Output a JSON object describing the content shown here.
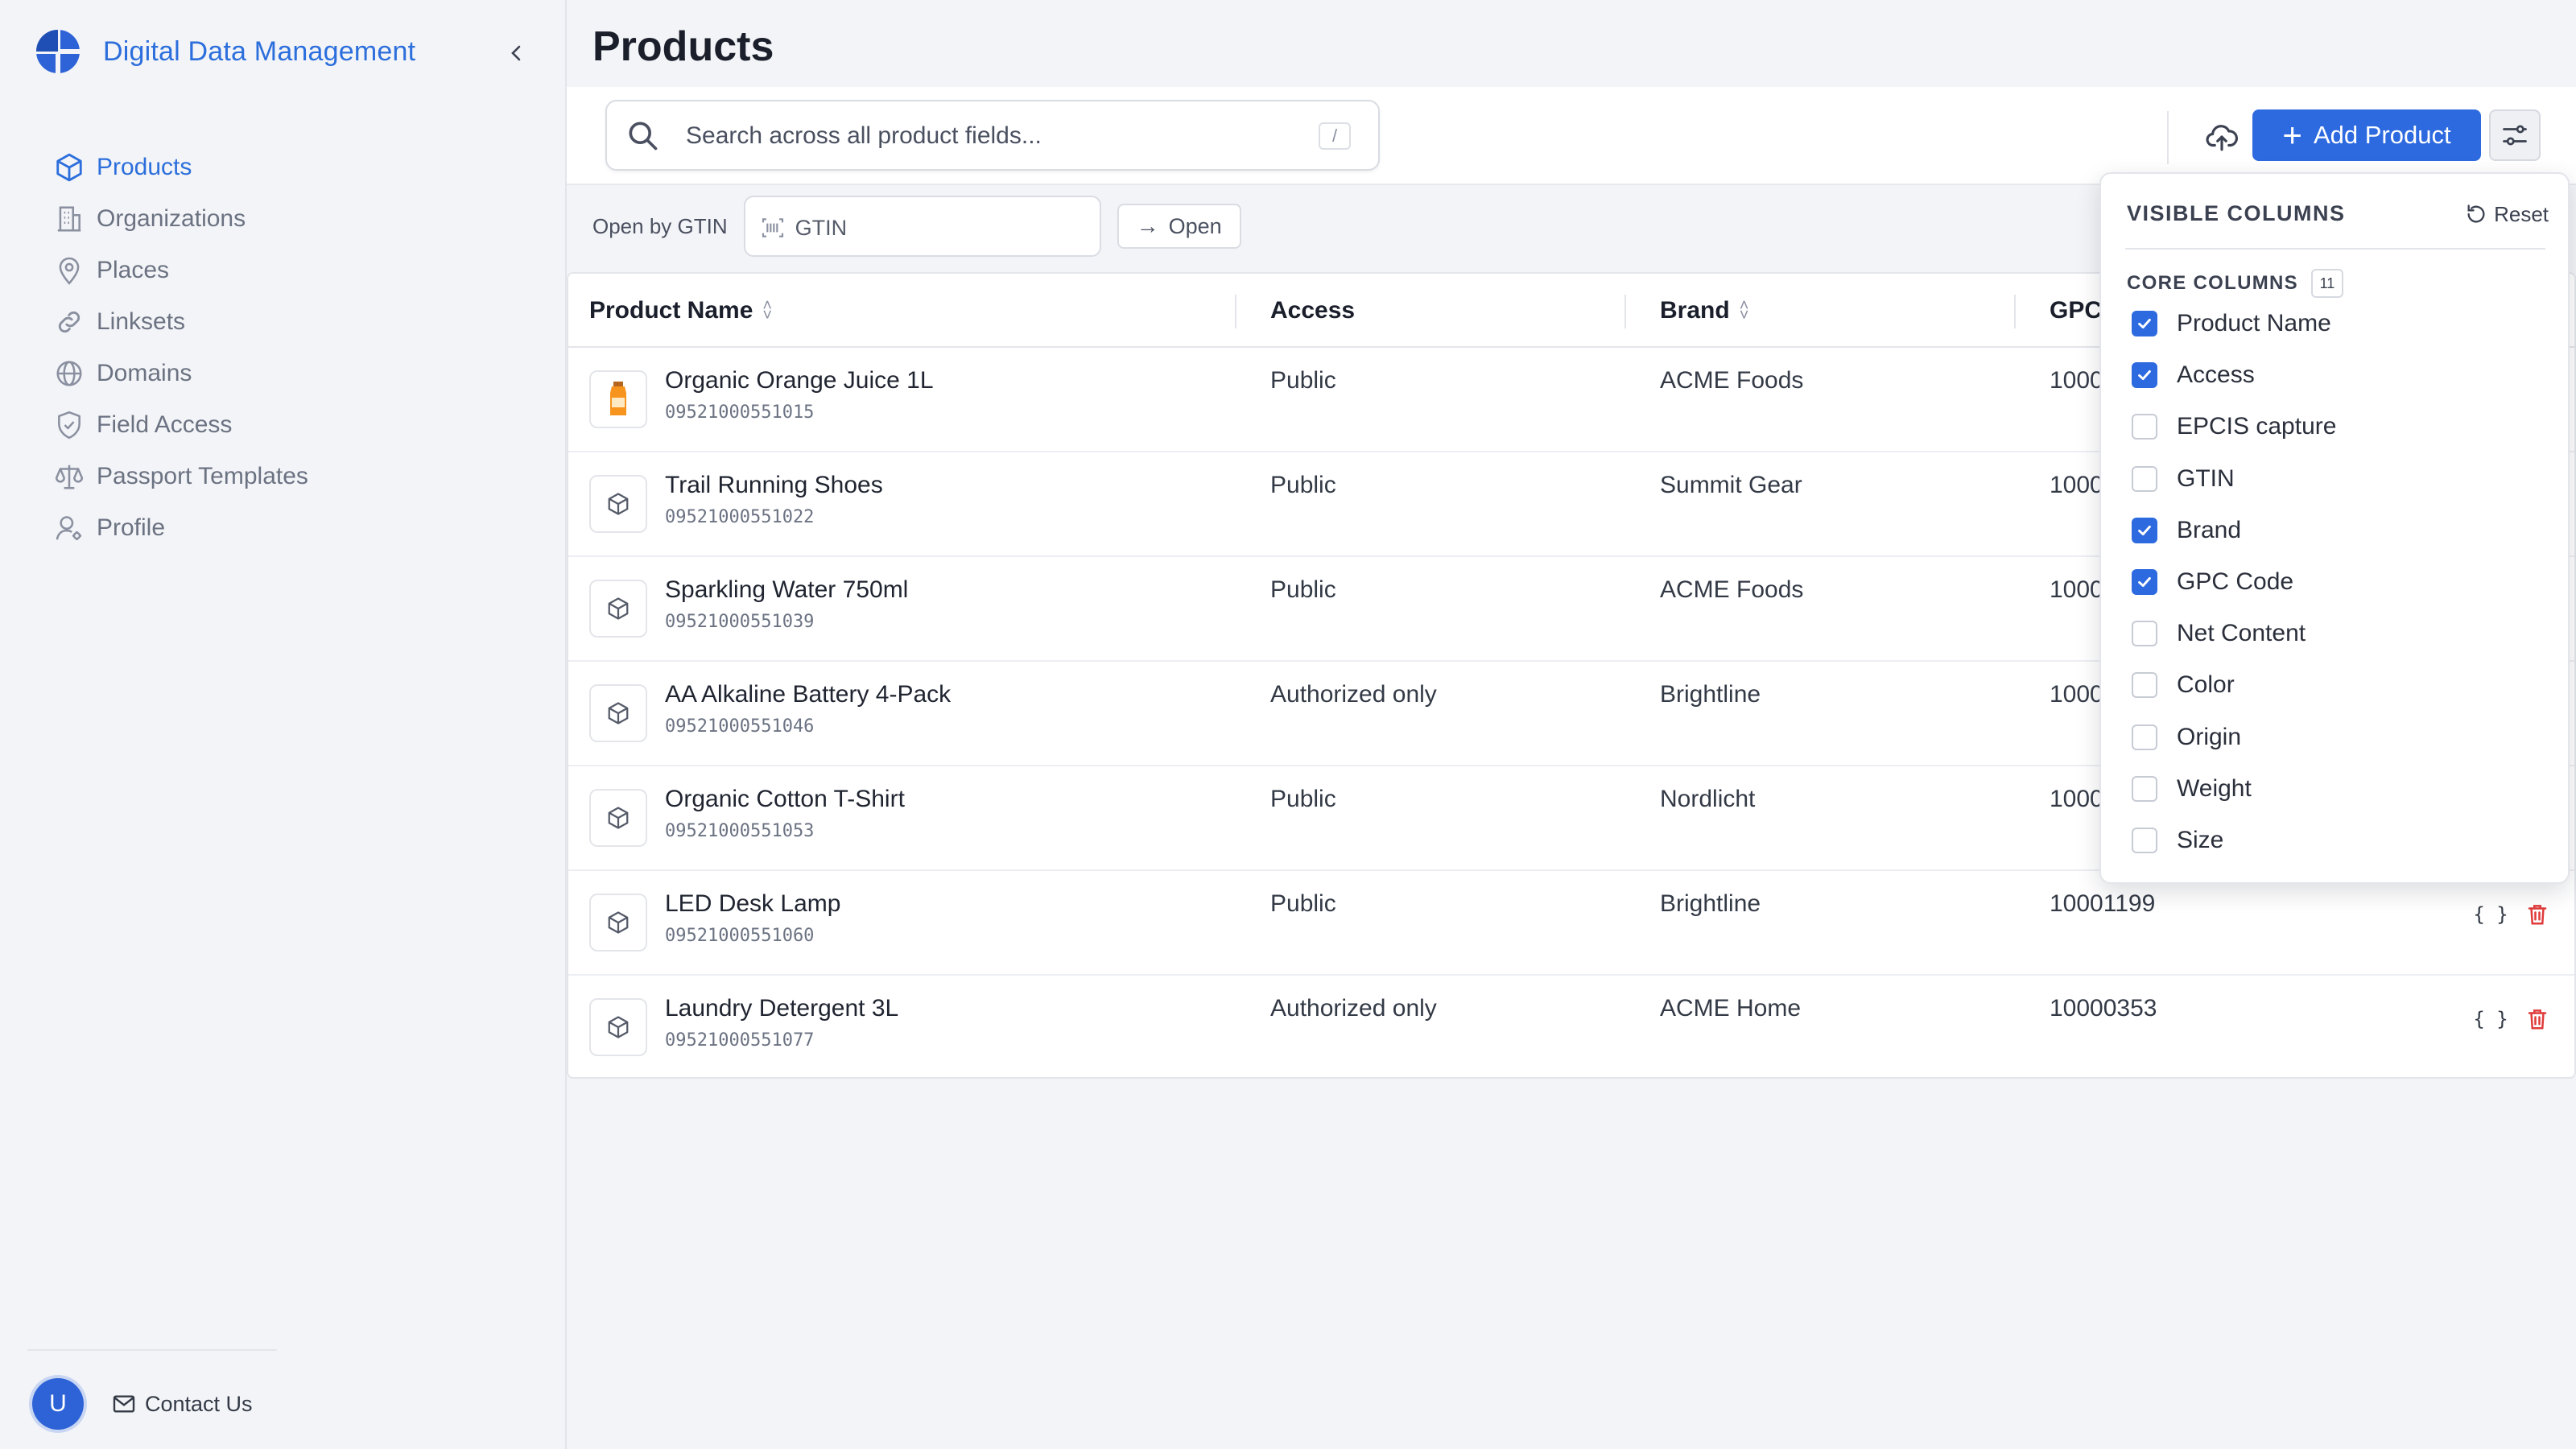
{
  "app": {
    "title": "Digital Data Management",
    "accent_color": "#2d6ae0"
  },
  "sidebar": {
    "items": [
      {
        "label": "Products",
        "icon": "cube-icon",
        "active": true
      },
      {
        "label": "Organizations",
        "icon": "building-icon",
        "active": false
      },
      {
        "label": "Places",
        "icon": "map-pin-icon",
        "active": false
      },
      {
        "label": "Linksets",
        "icon": "link-icon",
        "active": false
      },
      {
        "label": "Domains",
        "icon": "globe-icon",
        "active": false
      },
      {
        "label": "Field Access",
        "icon": "shield-check-icon",
        "active": false
      },
      {
        "label": "Passport Templates",
        "icon": "scale-icon",
        "active": false
      },
      {
        "label": "Profile",
        "icon": "user-cog-icon",
        "active": false
      }
    ],
    "avatar_initial": "U",
    "contact_label": "Contact Us"
  },
  "page": {
    "title": "Products"
  },
  "toolbar": {
    "search_placeholder": "Search across all product fields...",
    "search_shortcut": "/",
    "add_label": "Add Product"
  },
  "gtin_bar": {
    "label": "Open by GTIN",
    "placeholder": "GTIN",
    "open_label": "Open"
  },
  "table": {
    "headers": {
      "name": "Product Name",
      "access": "Access",
      "brand": "Brand",
      "gpc": "GPC Code"
    },
    "rows": [
      {
        "name": "Organic Orange Juice 1L",
        "gtin": "09521000551015",
        "access": "Public",
        "brand": "ACME Foods",
        "gpc": "1000"
      },
      {
        "name": "Trail Running Shoes",
        "gtin": "09521000551022",
        "access": "Public",
        "brand": "Summit Gear",
        "gpc": "1000"
      },
      {
        "name": "Sparkling Water 750ml",
        "gtin": "09521000551039",
        "access": "Public",
        "brand": "ACME Foods",
        "gpc": "1000"
      },
      {
        "name": "AA Alkaline Battery 4-Pack",
        "gtin": "09521000551046",
        "access": "Authorized only",
        "brand": "Brightline",
        "gpc": "1000"
      },
      {
        "name": "Organic Cotton T-Shirt",
        "gtin": "09521000551053",
        "access": "Public",
        "brand": "Nordlicht",
        "gpc": "1000"
      },
      {
        "name": "LED Desk Lamp",
        "gtin": "09521000551060",
        "access": "Public",
        "brand": "Brightline",
        "gpc": "10001199"
      },
      {
        "name": "Laundry Detergent 3L",
        "gtin": "09521000551077",
        "access": "Authorized only",
        "brand": "ACME Home",
        "gpc": "10000353"
      }
    ],
    "json_label": "{ }"
  },
  "columns_popover": {
    "title": "VISIBLE COLUMNS",
    "reset_label": "Reset",
    "section_title": "CORE COLUMNS",
    "section_count": "11",
    "items": [
      {
        "label": "Product Name",
        "checked": true
      },
      {
        "label": "Access",
        "checked": true
      },
      {
        "label": "EPCIS capture",
        "checked": false
      },
      {
        "label": "GTIN",
        "checked": false
      },
      {
        "label": "Brand",
        "checked": true
      },
      {
        "label": "GPC Code",
        "checked": true
      },
      {
        "label": "Net Content",
        "checked": false
      },
      {
        "label": "Color",
        "checked": false
      },
      {
        "label": "Origin",
        "checked": false
      },
      {
        "label": "Weight",
        "checked": false
      },
      {
        "label": "Size",
        "checked": false
      }
    ]
  }
}
